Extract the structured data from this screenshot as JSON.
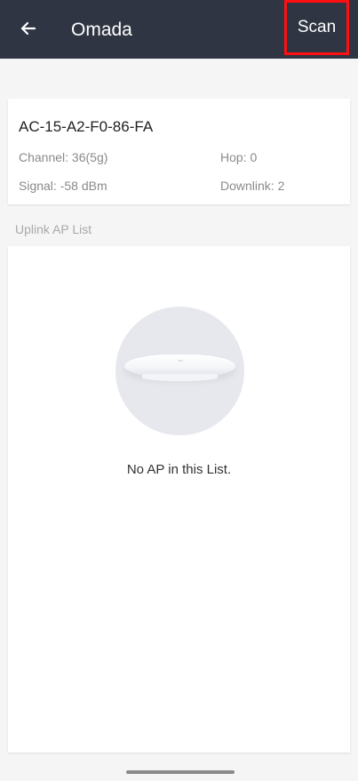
{
  "appbar": {
    "back_icon": "arrow-left-icon",
    "title": "Omada",
    "scan_label": "Scan",
    "highlight_color": "#ff1010",
    "background": "#2f3542"
  },
  "ap_card": {
    "mac": "AC-15-A2-F0-86-FA",
    "channel": "Channel: 36(5g)",
    "hop": "Hop: 0",
    "signal": "Signal: -58 dBm",
    "downlink": "Downlink: 2"
  },
  "uplink": {
    "section_label": "Uplink AP List",
    "empty_text": "No AP in this List.",
    "illustration_icon": "access-point-device-icon"
  }
}
